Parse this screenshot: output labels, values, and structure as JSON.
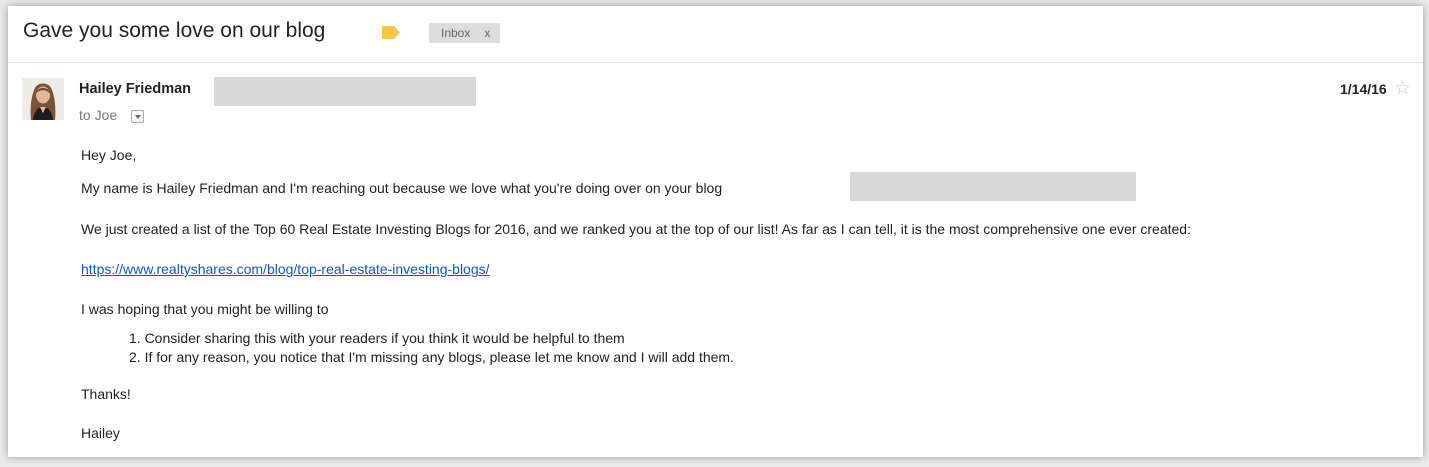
{
  "thread": {
    "subject": "Gave you some love on our blog",
    "label": "Inbox",
    "label_remove": "x",
    "important_color": "#f6c745"
  },
  "message": {
    "sender_name": "Hailey Friedman",
    "recipient": "to Joe",
    "date": "1/14/16",
    "star": "☆"
  },
  "body": {
    "greeting": "Hey Joe,",
    "intro": "My name is Hailey Friedman and I'm reaching out because we love what you're doing over on your blog",
    "announcement": "We just created a list of the Top 60 Real Estate Investing Blogs for 2016, and we ranked you at the top of our list! As far as I can tell, it is the most comprehensive one ever created:",
    "link": "https://www.realtyshares.com/blog/top-real-estate-investing-blogs/",
    "ask": "I was hoping that you might be willing to",
    "list": [
      "1. Consider sharing this with your readers if you think it would be helpful to them",
      "2. If for any reason, you notice that I'm missing any blogs, please let me know and I will add them."
    ],
    "thanks": "Thanks!",
    "signature": "Hailey"
  }
}
